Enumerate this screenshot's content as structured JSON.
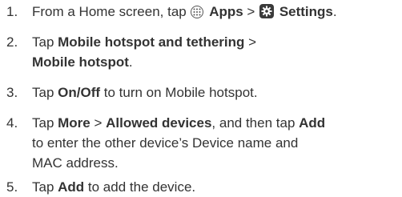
{
  "steps": [
    {
      "number": "1.",
      "lines": [
        {
          "t1": "From a Home screen, tap ",
          "b1": "Apps",
          "t2": " > ",
          "b2": "Settings",
          "t3": "."
        }
      ],
      "icons": [
        "apps-icon",
        "settings-gear-icon"
      ]
    },
    {
      "number": "2.",
      "lines": [
        {
          "t1": "Tap ",
          "b1": "Mobile hotspot and tethering",
          "t2": " >"
        },
        {
          "b1": "Mobile hotspot",
          "t2": "."
        }
      ]
    },
    {
      "number": "3.",
      "lines": [
        {
          "t1": "Tap ",
          "b1": "On/Off",
          "t2": " to turn on Mobile hotspot."
        }
      ]
    },
    {
      "number": "4.",
      "lines": [
        {
          "t1": "Tap ",
          "b1": "More",
          "t2": " > ",
          "b2": "Allowed devices",
          "t3": ", and then tap ",
          "b3": "Add"
        },
        {
          "t1": "to enter the other device’s Device name and"
        },
        {
          "t1": "MAC address."
        }
      ]
    },
    {
      "number": "5.",
      "lines": [
        {
          "t1": "Tap ",
          "b1": "Add",
          "t2": " to add the device."
        }
      ]
    }
  ]
}
